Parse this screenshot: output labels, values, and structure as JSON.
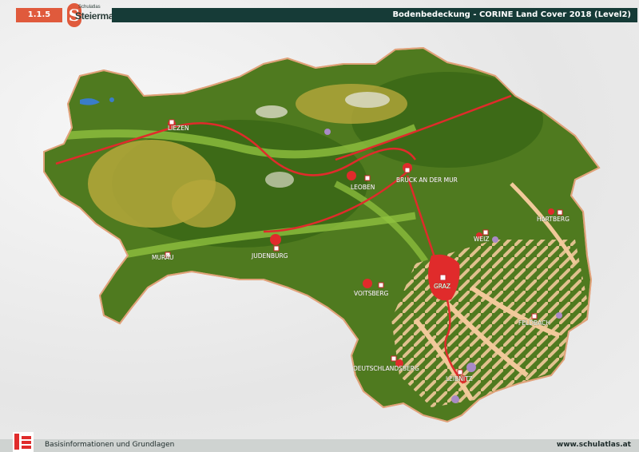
{
  "header": {
    "section_number": "1.1.5",
    "logo_small": "Schulatlas",
    "logo_big": "Steiermark",
    "logo_letter": "S",
    "title": "Bodenbedeckung - CORINE Land Cover 2018 (Level2)"
  },
  "map": {
    "colors": {
      "forest": "#4f7a1f",
      "forest_dark": "#3d6a17",
      "agriculture": "#f1c99a",
      "grassland": "#8fc13f",
      "scrub": "#b5a83b",
      "rock": "#dcdcc8",
      "urban": "#e02b2b",
      "water": "#3a7dc9",
      "orchard": "#a98ac6",
      "border": "#e0a27a"
    },
    "cities": [
      {
        "name": "LIEZEN"
      },
      {
        "name": "LEOBEN"
      },
      {
        "name": "BRUCK AN DER MUR"
      },
      {
        "name": "HARTBERG"
      },
      {
        "name": "WEIZ"
      },
      {
        "name": "MURAU"
      },
      {
        "name": "JUDENBURG"
      },
      {
        "name": "GRAZ"
      },
      {
        "name": "VOITSBERG"
      },
      {
        "name": "FELDBACH"
      },
      {
        "name": "DEUTSCHLANDSBERG"
      },
      {
        "name": "LEIBNITZ"
      }
    ]
  },
  "footer": {
    "left_text": "Basisinformationen und Grundlagen",
    "right_text": "www.schulatlas.at"
  }
}
